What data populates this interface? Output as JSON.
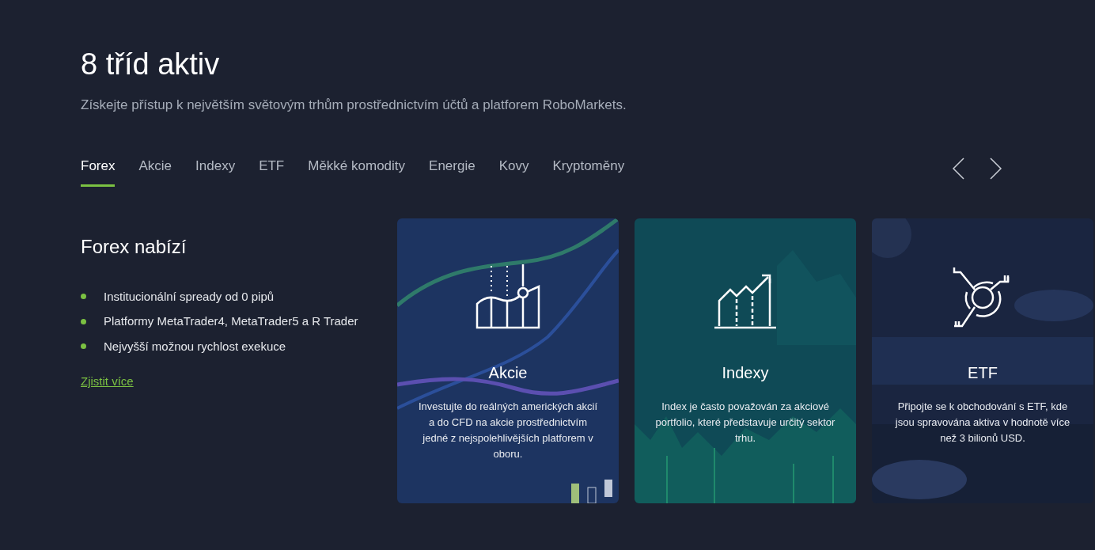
{
  "header": {
    "title": "8 tříd aktiv",
    "subtitle": "Získejte přístup k největším světovým trhům prostřednictvím účtů a platforem RoboMarkets."
  },
  "tabs": [
    {
      "label": "Forex",
      "selected": true
    },
    {
      "label": "Akcie",
      "selected": false
    },
    {
      "label": "Indexy",
      "selected": false
    },
    {
      "label": "ETF",
      "selected": false
    },
    {
      "label": "Měkké komodity",
      "selected": false
    },
    {
      "label": "Energie",
      "selected": false
    },
    {
      "label": "Kovy",
      "selected": false
    },
    {
      "label": "Kryptoměny",
      "selected": false
    }
  ],
  "offer": {
    "title": "Forex nabízí",
    "items": [
      "Institucionální spready od 0 pipů",
      "Platformy MetaTrader4, MetaTrader5 a R Trader",
      "Nejvyšší možnou rychlost exekuce"
    ],
    "link": "Zjistit více"
  },
  "cards": [
    {
      "kind": "stocks",
      "title": "Akcie",
      "text": "Investujte do reálných amerických akcií a do CFD na akcie prostřednictvím jedné z nejspolehlivějších platforem v oboru."
    },
    {
      "kind": "index",
      "title": "Indexy",
      "text": "Index je často považován za akciové portfolio, které představuje určitý sektor trhu."
    },
    {
      "kind": "etf",
      "title": "ETF",
      "text": "Připojte se k obchodování s ETF, kde jsou spravována aktiva v hodnotě více než 3 bilionů USD."
    }
  ]
}
